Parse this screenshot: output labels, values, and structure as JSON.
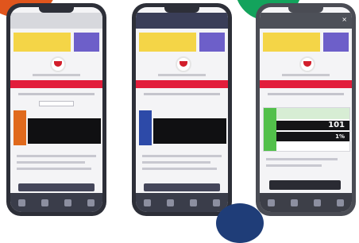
{
  "screens": [
    {
      "title": "",
      "red_bar_label": "",
      "card_heading": "",
      "bottom_button": ""
    },
    {
      "title": "",
      "red_bar_label": "",
      "card_heading": "",
      "bottom_button": ""
    },
    {
      "title": "",
      "red_bar_label": "",
      "card_heading": "",
      "row1_value": "101",
      "row2_value": "1%",
      "bottom_button": ""
    }
  ],
  "colors": {
    "accent_red": "#e21d3b",
    "banner_yellow": "#f4d547",
    "banner_purple": "#6d5fc9",
    "corner_orange": "#e0551d",
    "corner_green": "#13a35c",
    "corner_navy": "#1f3d78"
  }
}
